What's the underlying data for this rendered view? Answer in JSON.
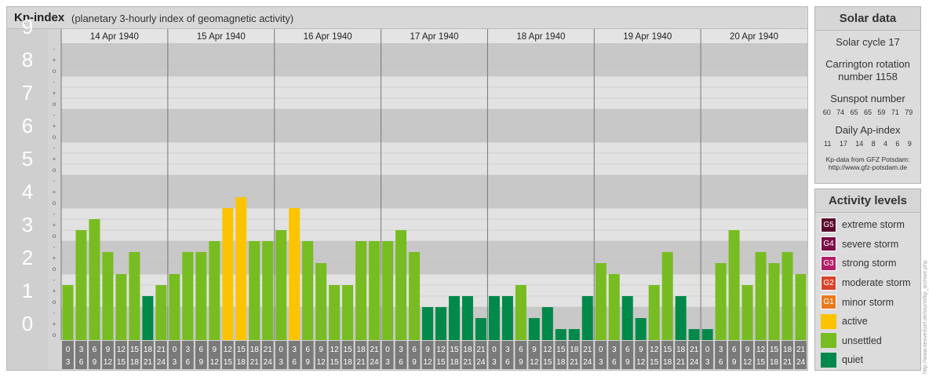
{
  "header": {
    "title": "Kp-index",
    "subtitle": "(planetary 3-hourly index of geomagnetic activity)"
  },
  "chart_data": {
    "type": "bar",
    "title": "Kp-index",
    "subtitle": "(planetary 3-hourly index of geomagnetic activity)",
    "ylim": [
      0,
      9
    ],
    "y_tick_labels": [
      "0",
      "1",
      "2",
      "3",
      "4",
      "5",
      "6",
      "7",
      "8",
      "9"
    ],
    "y_minor_labels": [
      "o",
      "+",
      "-"
    ],
    "days": [
      "14 Apr 1940",
      "15 Apr 1940",
      "16 Apr 1940",
      "17 Apr 1940",
      "18 Apr 1940",
      "19 Apr 1940",
      "20 Apr 1940"
    ],
    "interval_labels": [
      [
        "0",
        "3"
      ],
      [
        "3",
        "6"
      ],
      [
        "6",
        "9"
      ],
      [
        "9",
        "12"
      ],
      [
        "12",
        "15"
      ],
      [
        "15",
        "18"
      ],
      [
        "18",
        "21"
      ],
      [
        "21",
        "24"
      ]
    ],
    "values": [
      [
        1.667,
        3.333,
        3.667,
        2.667,
        2.0,
        2.667,
        1.333,
        1.667
      ],
      [
        2.0,
        2.667,
        2.667,
        3.0,
        4.0,
        4.333,
        3.0,
        3.0
      ],
      [
        3.333,
        4.0,
        3.0,
        2.333,
        1.667,
        1.667,
        3.0,
        3.0
      ],
      [
        3.0,
        3.333,
        2.667,
        1.0,
        1.0,
        1.333,
        1.333,
        0.667
      ],
      [
        1.333,
        1.333,
        1.667,
        0.667,
        1.0,
        0.333,
        0.333,
        1.333
      ],
      [
        2.333,
        2.0,
        1.333,
        0.667,
        1.667,
        2.667,
        1.333,
        0.333
      ],
      [
        0.333,
        2.333,
        3.333,
        1.667,
        2.667,
        2.333,
        2.667,
        2.0
      ]
    ],
    "grid": true
  },
  "solar": {
    "title": "Solar data",
    "cycle": "Solar cycle 17",
    "carrington_line1": "Carrington rotation",
    "carrington_line2": "number 1158",
    "sunspot_title": "Sunspot number",
    "sunspot_values": [
      "60",
      "74",
      "65",
      "65",
      "59",
      "71",
      "79"
    ],
    "ap_title": "Daily Ap-index",
    "ap_values": [
      "11",
      "17",
      "14",
      "8",
      "4",
      "6",
      "9"
    ],
    "credit_line1": "Kp-data from GFZ Potsdam:",
    "credit_line2": "http://www.gfz-potsdam.de"
  },
  "activity": {
    "title": "Activity levels",
    "items": [
      {
        "code": "G5",
        "label": "extreme storm",
        "color": "#5b0a2e"
      },
      {
        "code": "G4",
        "label": "severe storm",
        "color": "#7a1048"
      },
      {
        "code": "G3",
        "label": "strong storm",
        "color": "#b01e6a"
      },
      {
        "code": "G2",
        "label": "moderate storm",
        "color": "#d9412b"
      },
      {
        "code": "G1",
        "label": "minor storm",
        "color": "#e87a1c"
      },
      {
        "code": "",
        "label": "active",
        "color": "#fcc400"
      },
      {
        "code": "",
        "label": "unsettled",
        "color": "#77bc20"
      },
      {
        "code": "",
        "label": "quiet",
        "color": "#01894a"
      }
    ]
  },
  "colors": {
    "quiet": "#01894a",
    "unsettled": "#77bc20",
    "active": "#fcc400"
  },
  "watermark": "http://www.tiesverloef.de/sturm/kp_archive.php"
}
